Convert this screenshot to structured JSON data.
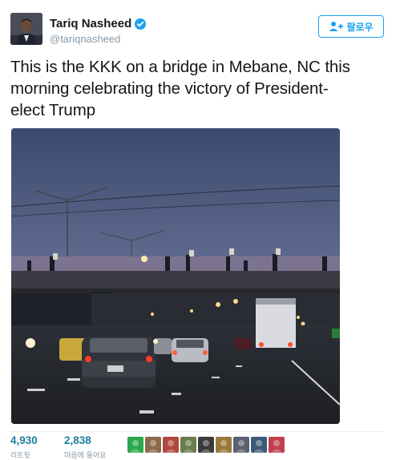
{
  "user": {
    "name": "Tariq Nasheed",
    "handle": "@tariqnasheed",
    "verified": true
  },
  "follow_button": {
    "label": "팔로우",
    "icon": "add-person-icon"
  },
  "tweet": {
    "text_lines": [
      "This is the KKK on a bridge in Mebane, NC this",
      "morning celebrating the victory of President-",
      "elect Trump"
    ]
  },
  "stats": {
    "retweets": {
      "value": "4,930",
      "label": "리트윗"
    },
    "likes": {
      "value": "2,838",
      "label": "마음에 들어요"
    }
  },
  "likers": [
    {
      "name": "liker-1",
      "color": "#2ca84d"
    },
    {
      "name": "liker-2",
      "color": "#8a6a4a"
    },
    {
      "name": "liker-3",
      "color": "#b0483c"
    },
    {
      "name": "liker-4",
      "color": "#6a7b4c"
    },
    {
      "name": "liker-5",
      "color": "#3b3b3b"
    },
    {
      "name": "liker-6",
      "color": "#9a7a3a"
    },
    {
      "name": "liker-7",
      "color": "#5a6070"
    },
    {
      "name": "liker-8",
      "color": "#3e5a78"
    },
    {
      "name": "liker-9",
      "color": "#c04050"
    }
  ],
  "colors": {
    "accent": "#1da1f2",
    "stat_value": "#1e7e9e"
  }
}
